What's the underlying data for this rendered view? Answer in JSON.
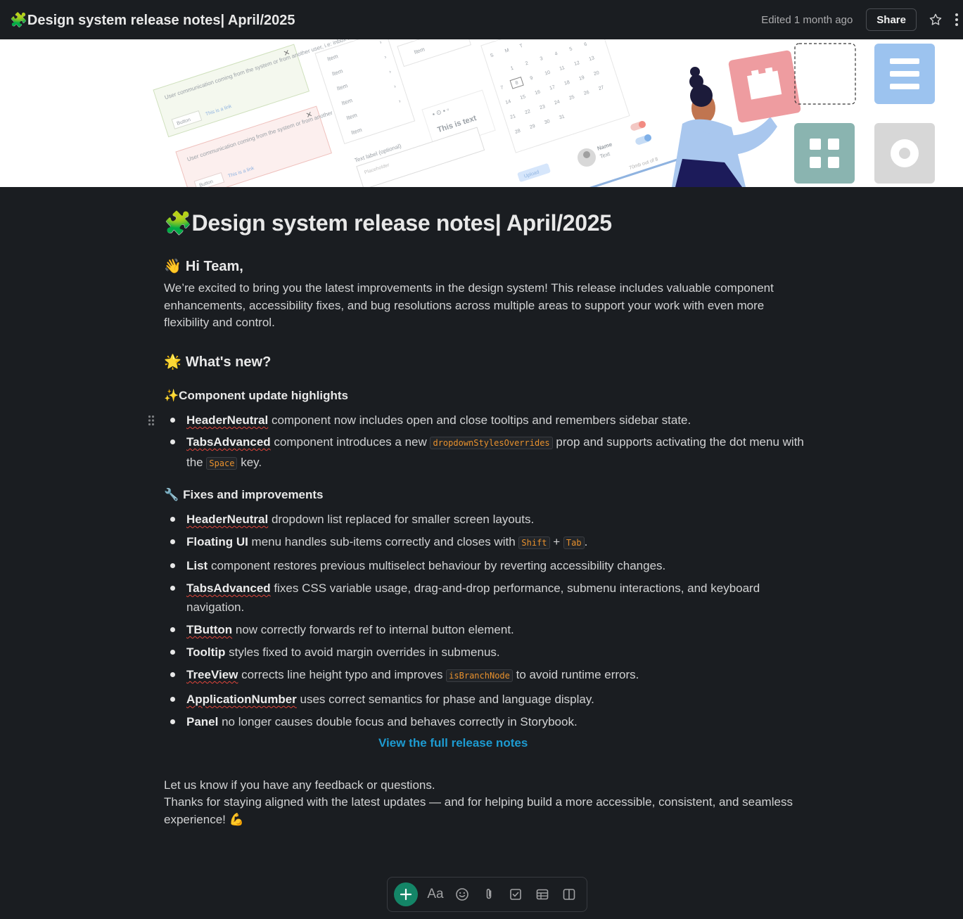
{
  "topbar": {
    "title": "🧩Design system release notes| April/2025",
    "edited": "Edited 1 month ago",
    "share_label": "Share"
  },
  "banner": {
    "alert_text_1": "User communication coming from the system or from another user, i.e: inbox message",
    "alert_link": "This is a link",
    "alert_button": "Button",
    "list_item": "Item",
    "card_text": "This is text",
    "field_label": "Text label (optional)",
    "field_placeholder": "Placeholder",
    "user_name": "Name",
    "user_text": "Text",
    "upload_label": "Upload",
    "file_size": "70mb out of 8",
    "calendar_days": [
      "S",
      "M",
      "T"
    ],
    "calendar_numbers": [
      "1",
      "2",
      "3",
      "4",
      "5",
      "6",
      "7",
      "8",
      "9",
      "10",
      "11",
      "12",
      "13",
      "14",
      "15",
      "16",
      "17",
      "18",
      "19",
      "20",
      "21",
      "22",
      "23",
      "24",
      "25",
      "26",
      "27",
      "28",
      "29",
      "30",
      "31"
    ]
  },
  "doc": {
    "title": "🧩Design system release notes| April/2025",
    "greeting_emoji": "👋",
    "greeting": "Hi Team,",
    "intro": "We’re excited to bring you the latest improvements in the design system! This release includes valuable component enhancements, accessibility fixes, and bug resolutions across multiple areas to support your work with even more flexibility and control.",
    "whats_new_emoji": "🌟",
    "whats_new": "What's new?",
    "highlights_heading": "✨Component update highlights",
    "highlights": [
      {
        "name": "HeaderNeutral",
        "text": " component now includes open and close tooltips and remembers sidebar state."
      },
      {
        "name": "TabsAdvanced",
        "text_1": " component introduces a new ",
        "code_1": "dropdownStylesOverrides",
        "text_2": " prop and supports activating the dot menu with the ",
        "code_2": "Space",
        "text_3": " key."
      }
    ],
    "fixes_emoji": "🔧",
    "fixes_heading": "Fixes and improvements",
    "fixes": [
      {
        "name": "HeaderNeutral",
        "text": " dropdown list replaced for smaller screen layouts."
      },
      {
        "name": "Floating UI",
        "text_1": " menu handles sub-items correctly and closes with ",
        "code_1": "Shift",
        "text_2": " + ",
        "code_2": "Tab",
        "text_3": "."
      },
      {
        "name": "List",
        "text": " component restores previous multiselect behaviour by reverting accessibility changes."
      },
      {
        "name": "TabsAdvanced",
        "text": " fixes CSS variable usage, drag-and-drop performance, submenu interactions, and keyboard navigation."
      },
      {
        "name": "TButton",
        "text": " now correctly forwards ref to internal button element."
      },
      {
        "name": "Tooltip",
        "text": " styles fixed to avoid margin overrides in submenus."
      },
      {
        "name": "TreeView",
        "text_1": " corrects line height typo and improves ",
        "code_1": "isBranchNode",
        "text_2": " to avoid runtime errors."
      },
      {
        "name": "ApplicationNumber",
        "text": " uses correct semantics for phase and language display."
      },
      {
        "name": "Panel",
        "text": " no longer causes double focus and behaves correctly in Storybook."
      }
    ],
    "full_notes_link": "View the full release notes",
    "closing_1": "Let us know if you have any feedback or questions.",
    "closing_2": "Thanks for staying aligned with the latest updates — and for helping build a more accessible, consistent, and seamless experience! 💪"
  },
  "composer": {
    "format_label": "Aa",
    "icons": [
      "plus-icon",
      "text-format-icon",
      "emoji-icon",
      "attachment-icon",
      "checkbox-icon",
      "table-icon",
      "columns-icon"
    ]
  },
  "colors": {
    "background": "#1a1d21",
    "link": "#1d9bd1",
    "code": "#e8912d",
    "add_button": "#148567",
    "spell_underline": "#e0453a"
  }
}
